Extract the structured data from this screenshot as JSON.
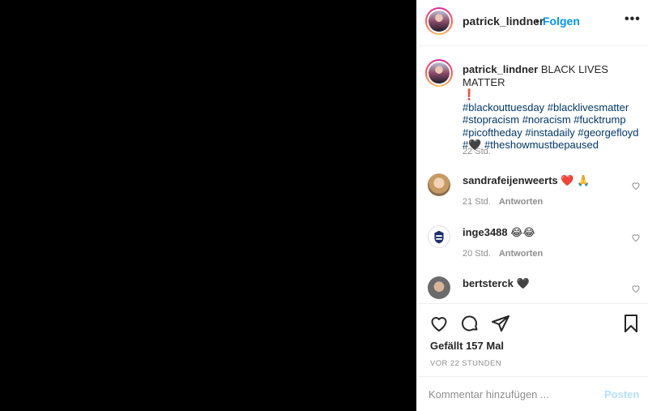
{
  "post": {
    "username": "patrick_lindner",
    "dot": "•",
    "follow_label": "Folgen",
    "more_label": "•••"
  },
  "caption": {
    "username": "patrick_lindner",
    "text": "BLACK LIVES MATTER",
    "emoji": "❗",
    "hashtags_line1": "#blackouttuesday #blacklivesmatter",
    "hashtags_line2": "#stopracism #noracism #fucktrump",
    "hashtags_line3": "#picoftheday #instadaily #georgefloyd",
    "hashtags_line4_prefix": "#",
    "hashtags_line4_emoji": "🖤",
    "hashtags_line4_tag": "#theshowmustbepaused",
    "time": "22 Std."
  },
  "comments": [
    {
      "username": "sandrafeijenweerts",
      "text": "❤️ 🙏",
      "time": "21 Std.",
      "reply": "Antworten"
    },
    {
      "username": "inge3488",
      "text": "😂😂",
      "time": "20 Std.",
      "reply": "Antworten"
    },
    {
      "username": "bertsterck",
      "text": "🖤",
      "time": "",
      "reply": ""
    }
  ],
  "actions": {
    "likes": "Gefällt 157 Mal",
    "ago": "VOR 22 STUNDEN"
  },
  "add_comment": {
    "placeholder": "Kommentar hinzufügen ...",
    "post_label": "Posten"
  },
  "colors": {
    "media_bg": "#000000",
    "link_blue": "#0095f6",
    "hashtag": "#00376b",
    "muted": "#8e8e8e",
    "post_disabled": "#b2dffc"
  },
  "icons": [
    "more-icon",
    "heart-icon",
    "comment-icon",
    "share-icon",
    "bookmark-icon",
    "comment-heart-icon"
  ]
}
